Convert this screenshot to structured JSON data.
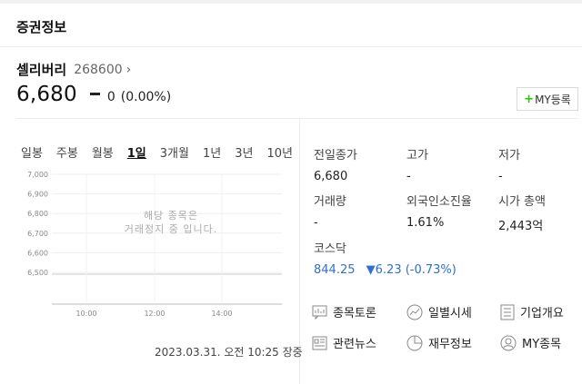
{
  "header": {
    "title": "증권정보"
  },
  "stock": {
    "name": "셀리버리",
    "code": "268600",
    "price": "6,680",
    "change": "0",
    "change_rate": "(0.00%)",
    "my_button_label": "MY등록"
  },
  "period_tabs": [
    {
      "label": "일봉",
      "active": false
    },
    {
      "label": "주봉",
      "active": false
    },
    {
      "label": "월봉",
      "active": false
    },
    {
      "label": "1일",
      "active": true
    },
    {
      "label": "3개월",
      "active": false
    },
    {
      "label": "1년",
      "active": false
    },
    {
      "label": "3년",
      "active": false
    },
    {
      "label": "10년",
      "active": false
    }
  ],
  "chart_data": {
    "type": "line",
    "x_ticks": [
      "10:00",
      "12:00",
      "14:00"
    ],
    "y_ticks": [
      "7,000",
      "6,900",
      "6,800",
      "6,700",
      "6,600",
      "6,500"
    ],
    "ylim": [
      6500,
      7000
    ],
    "series": [],
    "overlay_text": [
      "해당 종목은",
      "거래정지 중 입니다."
    ]
  },
  "timestamp": "2023.03.31. 오전 10:25 장중",
  "info": {
    "prev_close": {
      "label": "전일종가",
      "value": "6,680"
    },
    "high": {
      "label": "고가",
      "value": "-"
    },
    "low": {
      "label": "저가",
      "value": "-"
    },
    "volume": {
      "label": "거래량",
      "value": "-"
    },
    "foreign_ratio": {
      "label": "외국인소진율",
      "value": "1.61%"
    },
    "market_cap": {
      "label": "시가 총액",
      "value": "2,443억"
    },
    "index": {
      "label": "코스닥",
      "value": "844.25",
      "change": "▼6.23 (-0.73%)"
    }
  },
  "links": {
    "discussion": "종목토론",
    "daily_quotes": "일별시세",
    "company_overview": "기업개요",
    "related_news": "관련뉴스",
    "financials": "재무정보",
    "my_stocks": "MY종목"
  },
  "colors": {
    "accent_green": "#1ec800",
    "down_blue": "#2e6fd1"
  }
}
